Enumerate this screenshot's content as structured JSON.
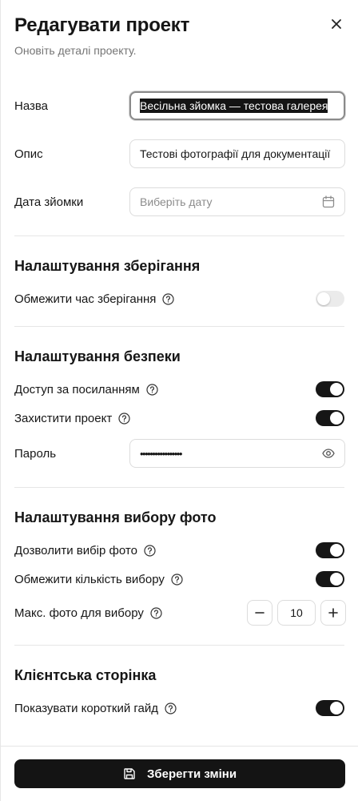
{
  "header": {
    "title": "Редагувати проект",
    "subtitle": "Оновіть деталі проекту."
  },
  "form": {
    "name_label": "Назва",
    "name_value": "Весільна зйомка — тестова галерея",
    "description_label": "Опис",
    "description_value": "Тестові фотографії для документації",
    "date_label": "Дата зйомки",
    "date_placeholder": "Виберіть дату"
  },
  "storage": {
    "title": "Налаштування зберігання",
    "limit_label": "Обмежити час зберігання",
    "limit_enabled": false
  },
  "security": {
    "title": "Налаштування безпеки",
    "link_access_label": "Доступ за посиланням",
    "link_access_enabled": true,
    "protect_label": "Захистити проект",
    "protect_enabled": true,
    "password_label": "Пароль",
    "password_value": "•••••••••••••••••"
  },
  "selection": {
    "title": "Налаштування вибору фото",
    "allow_label": "Дозволити вибір фото",
    "allow_enabled": true,
    "limit_label": "Обмежити кількість вибору",
    "limit_enabled": true,
    "max_label": "Макс. фото для вибору",
    "max_value": "10"
  },
  "client_page": {
    "title": "Клієнтська сторінка",
    "guide_label": "Показувати короткий гайд",
    "guide_enabled": true
  },
  "footer": {
    "save_label": "Зберегти зміни"
  },
  "icons": {
    "close": "close-icon",
    "calendar": "calendar-icon",
    "help": "help-circle-icon",
    "eye": "eye-icon",
    "save": "save-icon",
    "minus": "minus-icon",
    "plus": "plus-icon"
  },
  "colors": {
    "accent": "#141414",
    "toggle_off": "#ebebeb",
    "muted_text": "#757575",
    "border": "#dcdcdc"
  }
}
